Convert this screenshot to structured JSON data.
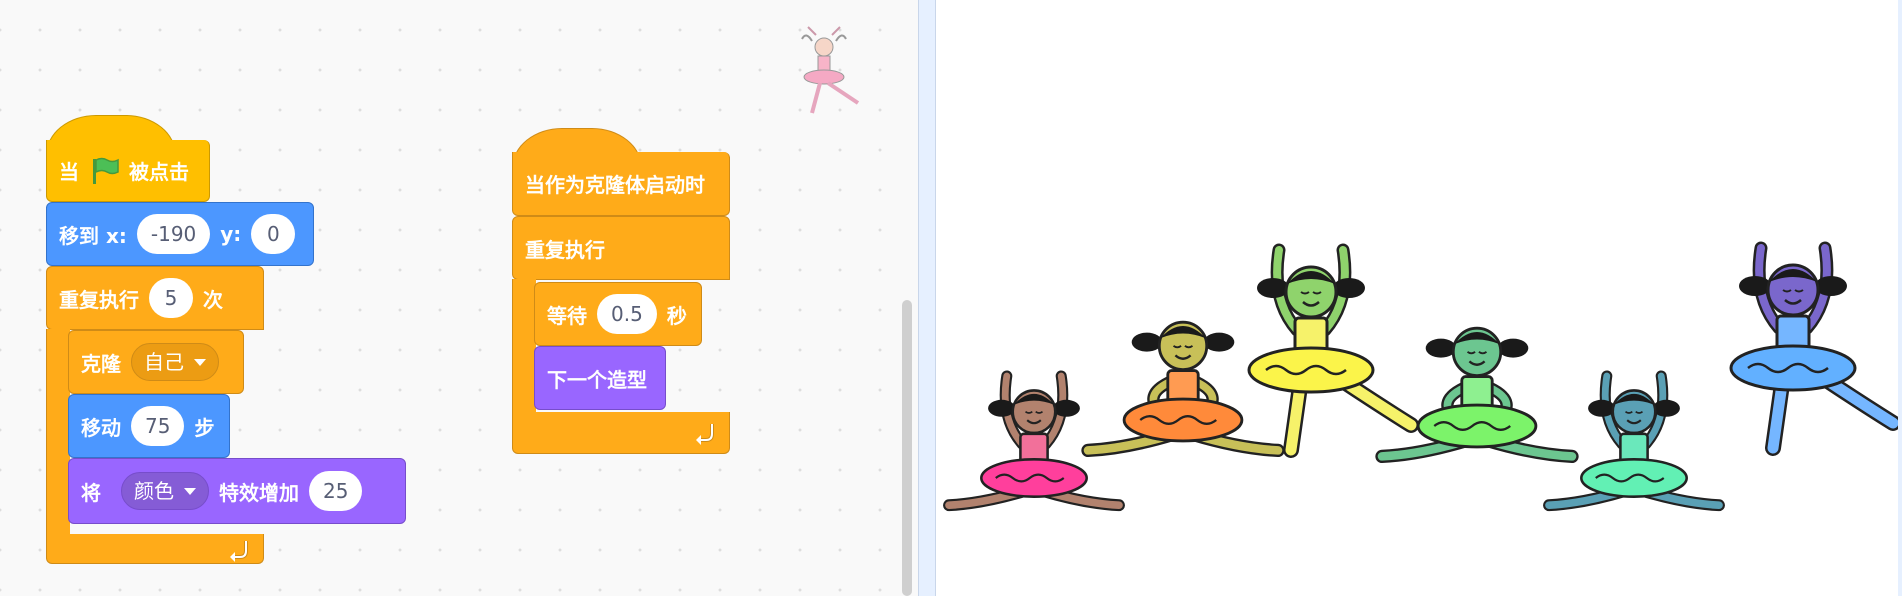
{
  "script1": {
    "hat": {
      "when": "当",
      "flag_icon": "green-flag-icon",
      "clicked": "被点击"
    },
    "goto": {
      "label": "移到 x:",
      "x": "-190",
      "ylabel": "y:",
      "y": "0"
    },
    "repeat": {
      "label": "重复执行",
      "count": "5",
      "times": "次",
      "loop_icon": "loop-arrow-icon"
    },
    "clone": {
      "label": "克隆",
      "target": "自己"
    },
    "move": {
      "label": "移动",
      "steps": "75",
      "unit": "步"
    },
    "effect": {
      "label": "将",
      "effect": "颜色",
      "action": "特效增加",
      "amount": "25"
    }
  },
  "script2": {
    "hat": {
      "label": "当作为克隆体启动时"
    },
    "forever": {
      "label": "重复执行",
      "loop_icon": "loop-arrow-icon"
    },
    "wait": {
      "label": "等待",
      "seconds": "0.5",
      "unit": "秒"
    },
    "next_costume": {
      "label": "下一个造型"
    }
  },
  "sprite_thumbnail": "ballerina-icon",
  "stage": {
    "dancers": [
      {
        "pose": "sitting-arms-up",
        "skin": "#b2826e",
        "top": "#f2709a",
        "tutu": "#ff3f9c"
      },
      {
        "pose": "sitting-hands-hips",
        "skin": "#c8c058",
        "top": "#ff9b52",
        "tutu": "#ff8a3a"
      },
      {
        "pose": "leaping-arms-up",
        "skin": "#8fd36c",
        "top": "#f6f26a",
        "tutu": "#fbf44a"
      },
      {
        "pose": "sitting-hands-hips",
        "skin": "#6cc690",
        "top": "#8ef090",
        "tutu": "#7cf36a"
      },
      {
        "pose": "sitting-arms-up",
        "skin": "#5aa0b5",
        "top": "#6ae8bb",
        "tutu": "#62f0b4"
      },
      {
        "pose": "leaping-arms-up",
        "skin": "#7a67cc",
        "top": "#75b6ff",
        "tutu": "#62b0ff"
      }
    ]
  }
}
